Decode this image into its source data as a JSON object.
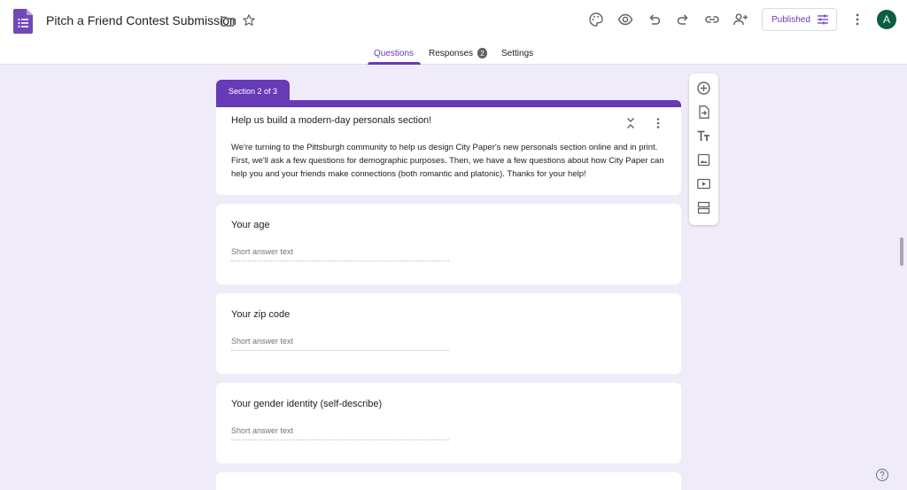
{
  "app": {
    "title": "Pitch a Friend Contest Submission",
    "publish_label": "Published",
    "avatar_letter": "A",
    "accent_color": "#673ab7",
    "background_color": "#f0ebf8"
  },
  "header_icons": [
    "palette-icon",
    "preview-eye-icon",
    "undo-icon",
    "redo-icon",
    "link-icon",
    "add-collaborator-icon"
  ],
  "tabs": [
    {
      "label": "Questions",
      "active": true
    },
    {
      "label": "Responses",
      "badge": "2"
    },
    {
      "label": "Settings"
    }
  ],
  "section": {
    "tag": "Section 2 of 3",
    "title": "Help us build a modern-day personals section!",
    "description": "We're turning to the Pittsburgh community to help us design City Paper's new personals section online and in print. First, we'll ask a few questions for demographic purposes. Then, we have a few questions about how City Paper can help you and your friends make connections (both romantic and platonic). Thanks for your help!"
  },
  "questions": [
    {
      "title": "Your age",
      "placeholder": "Short answer text"
    },
    {
      "title": "Your zip code",
      "placeholder": "Short answer text"
    },
    {
      "title": "Your gender identity (self-describe)",
      "placeholder": "Short answer text"
    }
  ],
  "side_toolbar": [
    "add-question-icon",
    "import-questions-icon",
    "add-title-icon",
    "add-image-icon",
    "add-video-icon",
    "add-section-icon"
  ]
}
